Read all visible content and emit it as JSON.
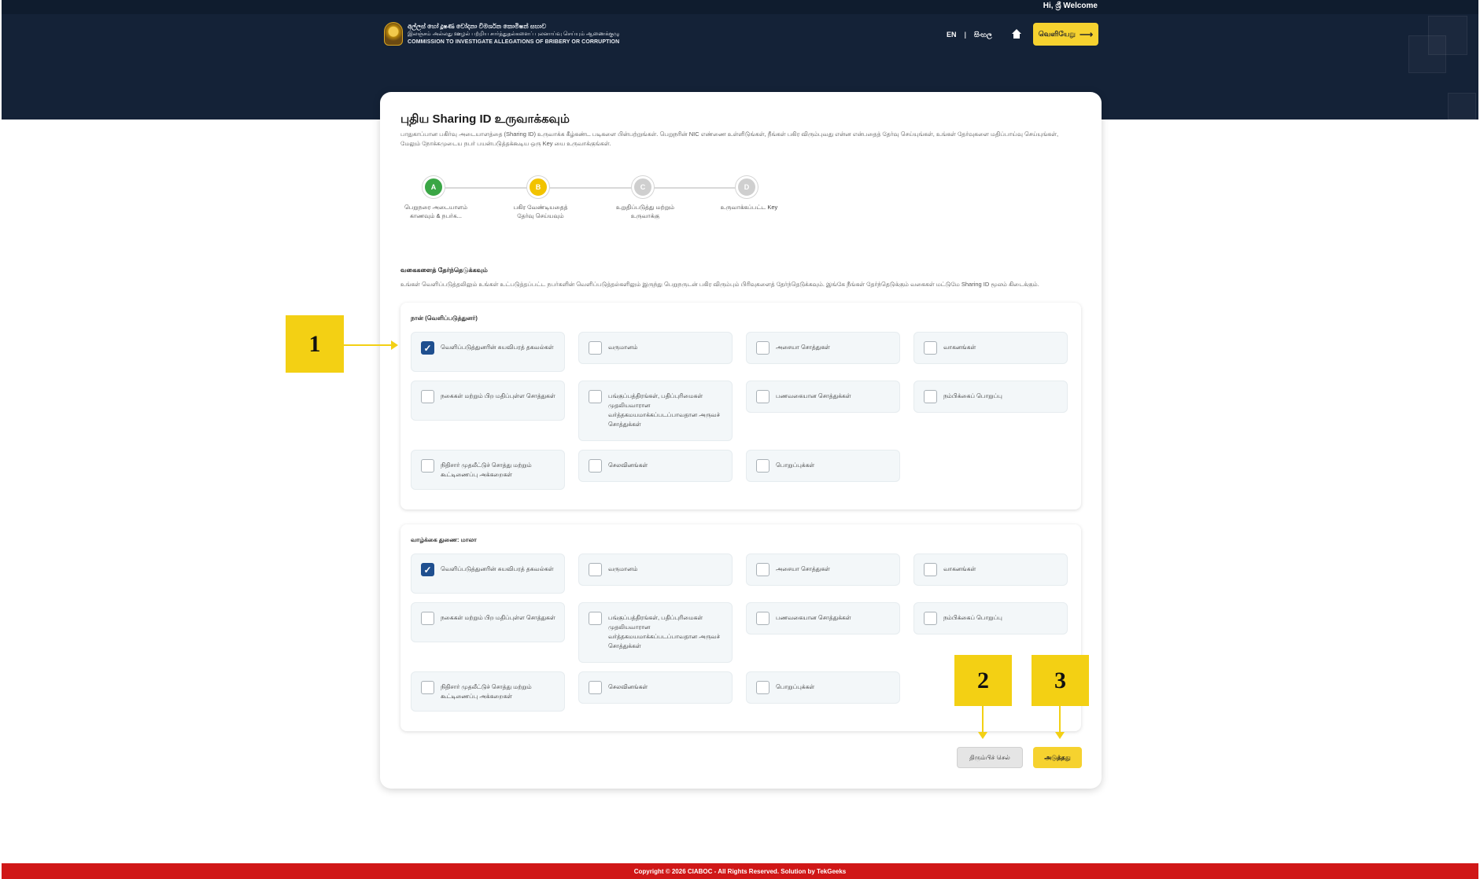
{
  "header": {
    "welcome": "Hi, ශ්‍රී Welcome",
    "logo_lines": [
      "අල්ලස් හෝ දූෂණ චෝදනා විමර්ශන කොමිෂන් සභාව",
      "இலஞ்சம் அல்லது ஊழல் பற்றிய சார்த்துதல்களைப் புலனாய்வு செய்யும் ஆணைக்குழு",
      "COMMISSION TO INVESTIGATE ALLEGATIONS OF BRIBERY OR CORRUPTION"
    ],
    "lang_en": "EN",
    "lang_si": "සිංහල",
    "logout_label": "வெளியேறு",
    "colors": {
      "header_bg": "#142237",
      "accent": "#f6d22f"
    }
  },
  "card": {
    "title": "புதிய Sharing ID உருவாக்கவும்",
    "description": "பாதுகாப்பான பகிர்வு அடையாளத்தை (Sharing ID) உருவாக்க கீழ்கண்ட படிகளை பின்பற்றுங்கள். பெறுநரின் NIC எண்ணை உள்ளிடுங்கள், நீங்கள் பகிர விரும்புவது என்ன என்பதைத் தேர்வு செய்யுங்கள், உங்கள் தேர்வுகளை மதிப்பாய்வு செய்யுங்கள், மேலும் நோக்கமுடைய நபர் பயன்படுத்தக்கூடிய ஒரு Key யை உருவாக்குங்கள்.",
    "steps": [
      {
        "letter": "A",
        "label": "பெறுநரை அடையாளம் காணவும் & நபர்க...",
        "state": "done",
        "color": "#3aa645"
      },
      {
        "letter": "B",
        "label": "பகிர வேண்டியதைத் தேர்வு செய்யவும்",
        "state": "active",
        "color": "#f2c300"
      },
      {
        "letter": "C",
        "label": "உறுதிப்படுத்து மற்றும் உருவாக்கு",
        "state": "pending",
        "color": "#cfcfcf"
      },
      {
        "letter": "D",
        "label": "உருவாக்கப்பட்ட Key",
        "state": "pending",
        "color": "#cfcfcf"
      }
    ],
    "section_heading": "வகைகளைத் தேர்ந்தெடுக்கவும்",
    "section_desc": "உங்கள் வெளிப்படுத்தலிலும் உங்கள் உட்படுத்தப்பட்ட நபர்களின் வெளிப்படுத்தல்களிலும் இருந்து பெறுநருடன் பகிர விரும்பும் பிரிவுகளைத் தேர்ந்தெடுக்கவும். இங்கே நீங்கள் தேர்ந்தெடுக்கும் வகைகள் மட்டுமே Sharing ID மூலம் கிடைக்கும்.",
    "groups": [
      {
        "title": "நான் (வெளிப்படுத்துனர்)",
        "options": [
          {
            "label": "வெளிப்படுத்துனரின் சுயவிபரத் தகவல்கள்",
            "checked": true
          },
          {
            "label": "வருமானம்",
            "checked": false
          },
          {
            "label": "அசையா சொத்துகள்",
            "checked": false
          },
          {
            "label": "வாகனங்கள்",
            "checked": false
          },
          {
            "label": "நகைகள் மற்றும் பிற மதிப்புள்ள சொத்துகள்",
            "checked": false
          },
          {
            "label": "பங்குப்பத்திரங்கள், பதிப்புரிமைகள் முதலியவாரான வர்த்தகமயமாக்கப்படப்பாவதான அருவச் சொத்துக்கள்",
            "checked": false
          },
          {
            "label": "பணவகையான சொத்துக்கள்",
            "checked": false
          },
          {
            "label": "நம்பிக்கைப் பொறுப்பு",
            "checked": false
          },
          {
            "label": "நிதிசார் முதலீட்டுச் சொத்து மற்றும் கூட்டிணைப்பு அக்கறைகள்",
            "checked": false
          },
          {
            "label": "செலவினங்கள்",
            "checked": false
          },
          {
            "label": "பொறுப்புக்கள்",
            "checked": false
          }
        ]
      },
      {
        "title": "வாழ்க்கை துணை: மாலா",
        "options": [
          {
            "label": "வெளிப்படுத்துனரின் சுயவிபரத் தகவல்கள்",
            "checked": true
          },
          {
            "label": "வருமானம்",
            "checked": false
          },
          {
            "label": "அசையா சொத்துகள்",
            "checked": false
          },
          {
            "label": "வாகனங்கள்",
            "checked": false
          },
          {
            "label": "நகைகள் மற்றும் பிற மதிப்புள்ள சொத்துகள்",
            "checked": false
          },
          {
            "label": "பங்குப்பத்திரங்கள், பதிப்புரிமைகள் முதலியவாரான வர்த்தகமயமாக்கப்படப்பாவதான அருவச் சொத்துக்கள்",
            "checked": false
          },
          {
            "label": "பணவகையான சொத்துக்கள்",
            "checked": false
          },
          {
            "label": "நம்பிக்கைப் பொறுப்பு",
            "checked": false
          },
          {
            "label": "நிதிசார் முதலீட்டுச் சொத்து மற்றும் கூட்டிணைப்பு அக்கறைகள்",
            "checked": false
          },
          {
            "label": "செலவினங்கள்",
            "checked": false
          },
          {
            "label": "பொறுப்புக்கள்",
            "checked": false
          }
        ]
      }
    ],
    "back_label": "திரும்பிச் செல்",
    "next_label": "அடுத்தது"
  },
  "callouts": [
    "1",
    "2",
    "3"
  ],
  "footer": {
    "text": "Copyright © 2026 CIABOC - All Rights Reserved. Solution by TekGeeks"
  }
}
